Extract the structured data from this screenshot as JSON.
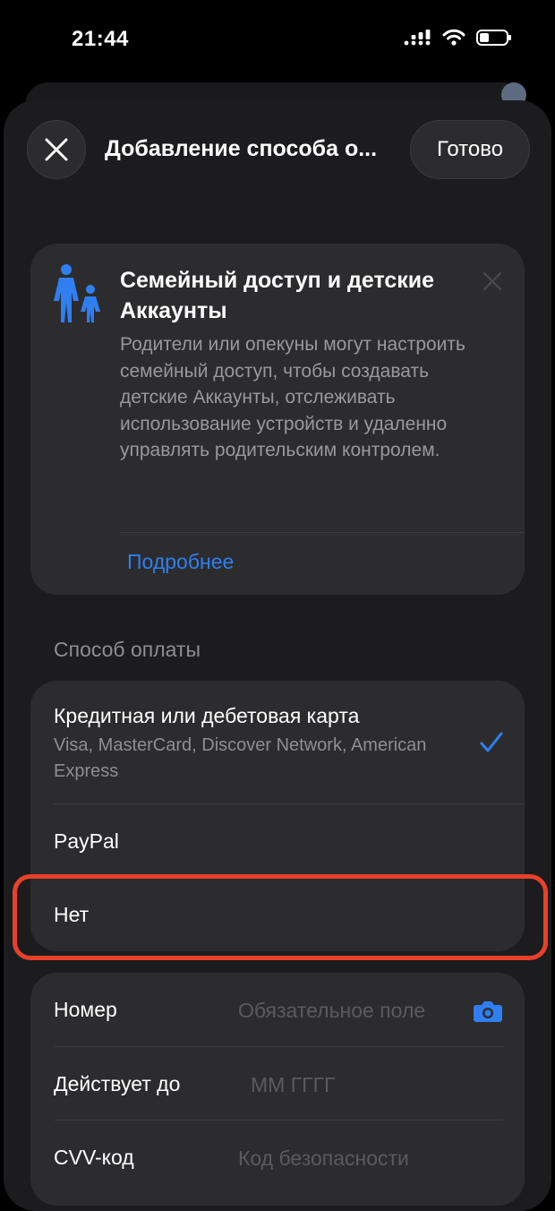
{
  "status_bar": {
    "time": "21:44",
    "battery_level": 0.35
  },
  "sheet": {
    "title": "Добавление способа о...",
    "done_label": "Готово"
  },
  "family_card": {
    "title": "Семейный доступ и детские Аккаунты",
    "description": "Родители или опекуны могут настроить семейный доступ, чтобы создавать детские Аккаунты, отслеживать использование устройств и удаленно управлять родительским контролем.",
    "link": "Подробнее"
  },
  "payment": {
    "header": "Способ оплаты",
    "options": [
      {
        "title": "Кредитная или дебетовая карта",
        "subtitle": "Visa, MasterCard, Discover Network, American Express",
        "selected": true
      },
      {
        "title": "PayPal",
        "selected": false
      },
      {
        "title": "Нет",
        "selected": false
      }
    ]
  },
  "card_form": {
    "number_label": "Номер",
    "number_placeholder": "Обязательное поле",
    "expiry_label": "Действует до",
    "expiry_placeholder": "ММ ГГГГ",
    "cvv_label": "CVV-код",
    "cvv_placeholder": "Код безопасности"
  },
  "colors": {
    "accent": "#2f7ff0",
    "highlight": "#e8412a",
    "sheet": "#1c1c1e",
    "card": "#2c2c2e"
  }
}
